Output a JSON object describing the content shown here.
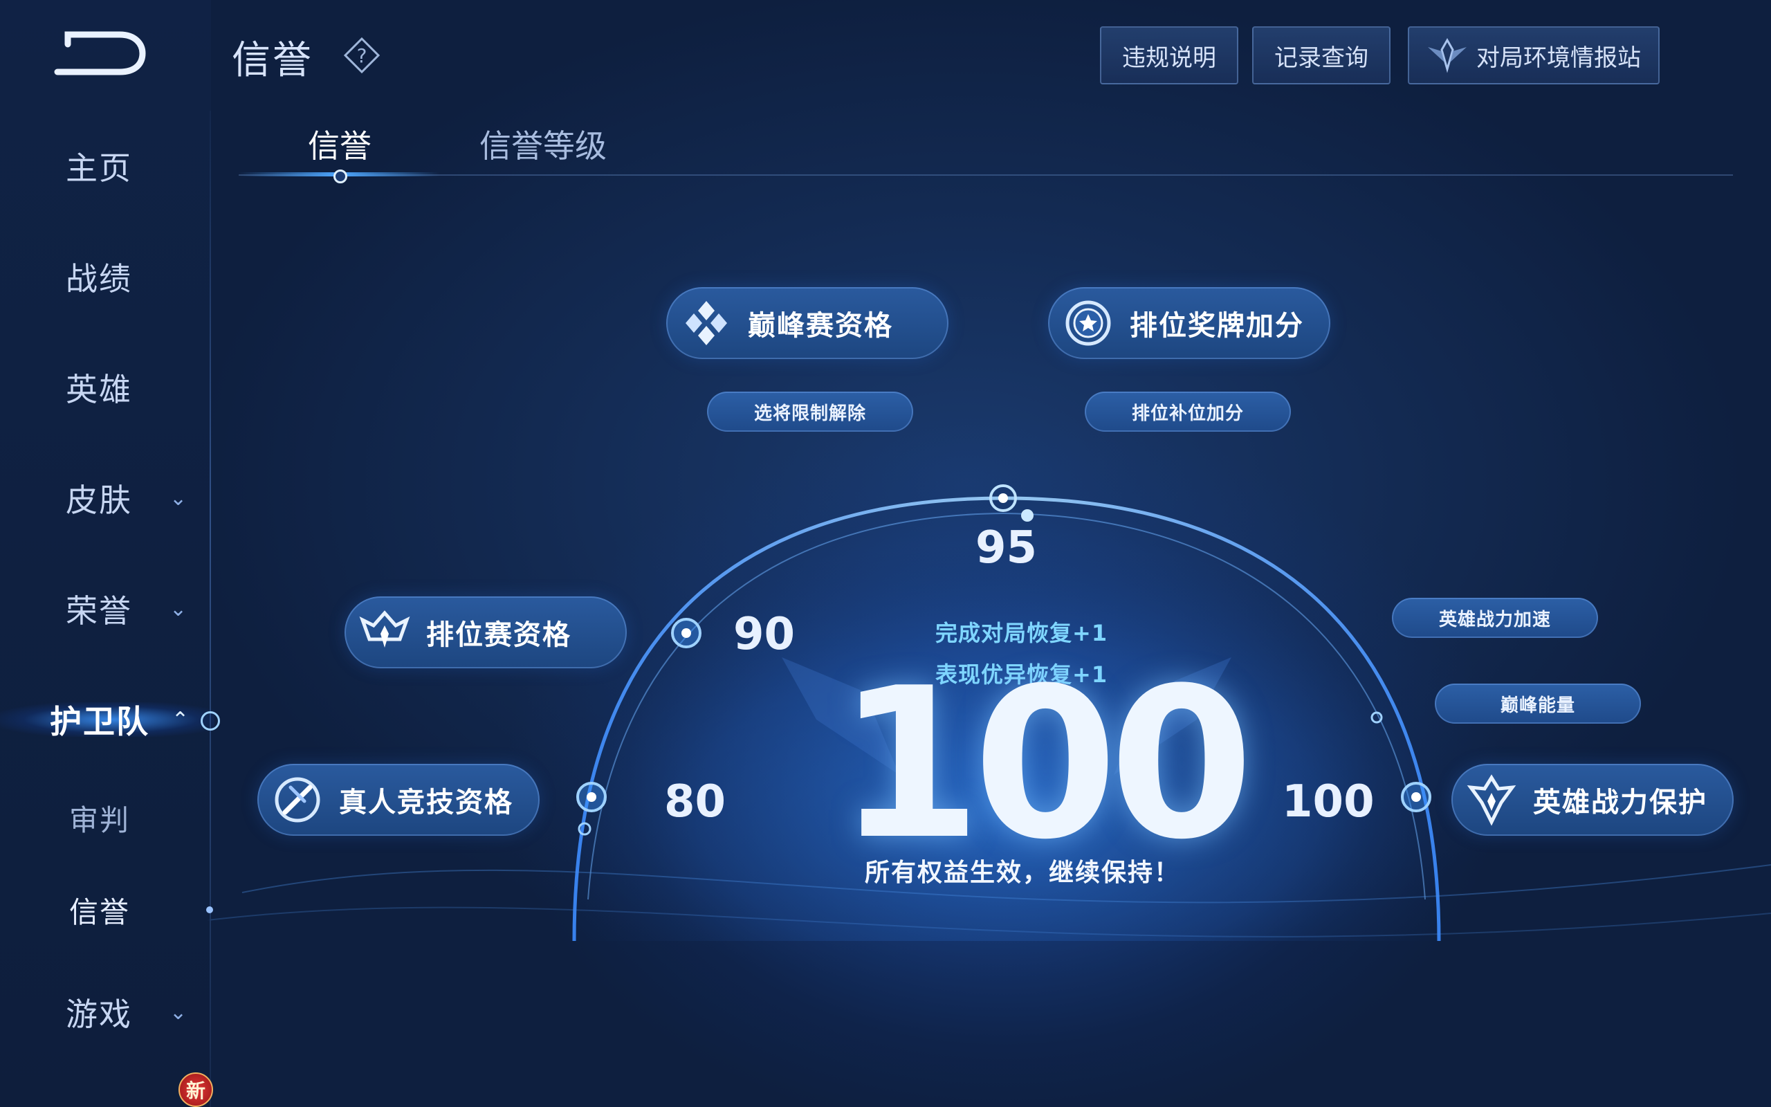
{
  "sidebar": {
    "items": [
      {
        "label": "主页"
      },
      {
        "label": "战绩"
      },
      {
        "label": "英雄"
      },
      {
        "label": "皮肤",
        "chevron": "chevron-down-icon"
      },
      {
        "label": "荣誉",
        "chevron": "chevron-down-icon"
      },
      {
        "label": "护卫队",
        "chevron": "chevron-up-icon"
      },
      {
        "label": "审判"
      },
      {
        "label": "信誉"
      },
      {
        "label": "游戏",
        "chevron": "chevron-down-icon"
      }
    ],
    "badge": "新"
  },
  "header": {
    "title": "信誉",
    "buttons": {
      "violation": "违规说明",
      "records": "记录查询",
      "report": "对局环境情报站"
    }
  },
  "tabs": [
    {
      "label": "信誉"
    },
    {
      "label": "信誉等级"
    }
  ],
  "benefits": {
    "peak": "巅峰赛资格",
    "rank_medal": "排位奖牌加分",
    "pick_limit": "选将限制解除",
    "rank_fill": "排位补位加分",
    "ranked": "排位赛资格",
    "human": "真人竞技资格",
    "hero_speed": "英雄战力加速",
    "peak_energy": "巅峰能量",
    "hero_protect": "英雄战力保护"
  },
  "scale": {
    "s80": "80",
    "s90": "90",
    "s95": "95",
    "s100": "100"
  },
  "score": {
    "value": "100",
    "restore_match": "完成对局恢复+1",
    "restore_perf": "表现优异恢复+1",
    "status": "所有权益生效，继续保持！"
  },
  "colors": {
    "accent": "#4da6ff",
    "restore": "#7fd6ff",
    "pill": "#2a5a9e"
  }
}
